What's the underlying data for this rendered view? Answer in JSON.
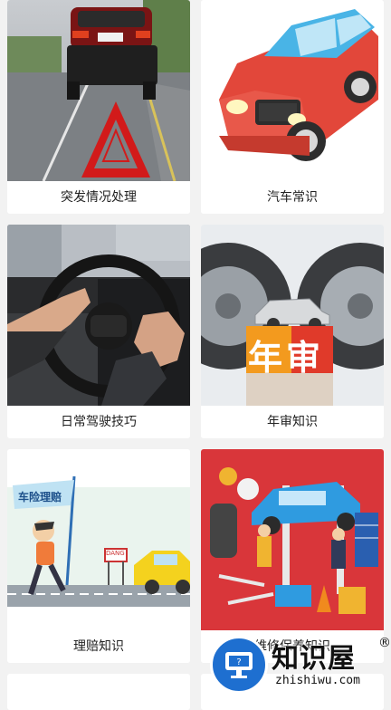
{
  "cards": [
    {
      "label": "突发情况处理",
      "image": "car-warning-triangle-photo"
    },
    {
      "label": "汽车常识",
      "image": "cartoon-red-car-illustration"
    },
    {
      "label": "日常驾驶技巧",
      "image": "steering-wheel-hands-photo"
    },
    {
      "label": "年审知识",
      "image": "annual-inspection-tires-photo",
      "image_text": "年审"
    },
    {
      "label": "理赔知识",
      "image": "insurance-claim-cartoon",
      "image_text": "车险理赔",
      "sign_text": "DANG"
    },
    {
      "label": "维修保养知识",
      "image": "car-repair-workshop-illustration"
    }
  ],
  "watermark": {
    "title": "知识屋",
    "registered": "®",
    "url": "zhishiwu.com",
    "icon": "monitor-icon"
  }
}
